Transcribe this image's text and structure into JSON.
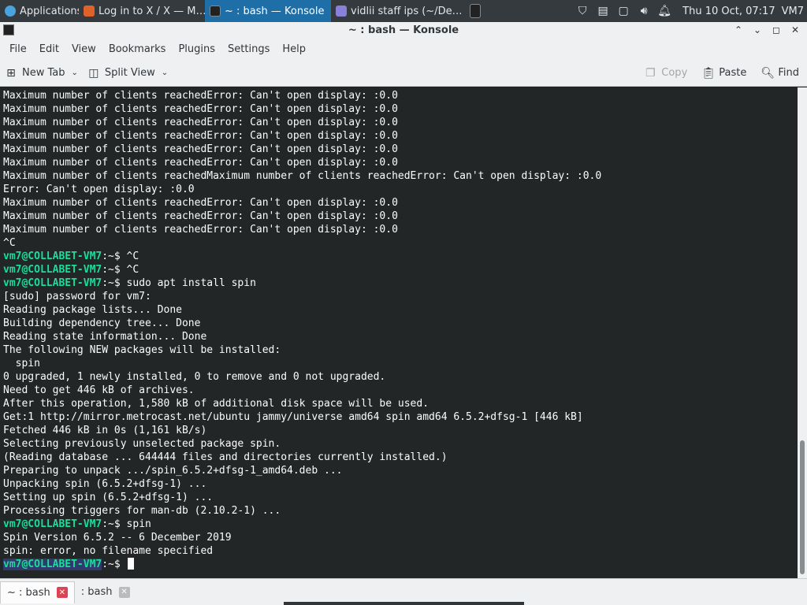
{
  "taskbar": {
    "tasks": [
      {
        "label": "Applications ⁝",
        "icon": "applications-icon"
      },
      {
        "label": "Log in to X / X — M…",
        "icon": "firefox-icon"
      },
      {
        "label": "~ : bash — Konsole",
        "icon": "terminal-icon",
        "active": true
      },
      {
        "label": "vidlii staff ips (~/De…",
        "icon": "text-editor-icon"
      },
      {
        "label": "",
        "icon": "terminal-icon"
      }
    ],
    "clock": "Thu 10 Oct, 07:17",
    "user": "VM7"
  },
  "window": {
    "title": "~ : bash — Konsole"
  },
  "menubar": {
    "items": [
      "File",
      "Edit",
      "View",
      "Bookmarks",
      "Plugins",
      "Settings",
      "Help"
    ]
  },
  "toolbar": {
    "new_tab": "New Tab",
    "split_view": "Split View",
    "copy": "Copy",
    "paste": "Paste",
    "find": "Find"
  },
  "terminal": {
    "prompt": "vm7@COLLABET-VM7",
    "prompt_suffix": ":~$ ",
    "lines": [
      {
        "text": "Maximum number of clients reachedError: Can't open display: :0.0"
      },
      {
        "text": "Maximum number of clients reachedError: Can't open display: :0.0"
      },
      {
        "text": "Maximum number of clients reachedError: Can't open display: :0.0"
      },
      {
        "text": "Maximum number of clients reachedError: Can't open display: :0.0"
      },
      {
        "text": "Maximum number of clients reachedError: Can't open display: :0.0"
      },
      {
        "text": "Maximum number of clients reachedError: Can't open display: :0.0"
      },
      {
        "text": "Maximum number of clients reachedMaximum number of clients reachedError: Can't open display: :0.0"
      },
      {
        "text": "Error: Can't open display: :0.0"
      },
      {
        "text": "Maximum number of clients reachedError: Can't open display: :0.0"
      },
      {
        "text": "Maximum number of clients reachedError: Can't open display: :0.0"
      },
      {
        "text": "Maximum number of clients reachedError: Can't open display: :0.0"
      },
      {
        "text": "^C"
      },
      {
        "prompt": true,
        "cmd": "^C"
      },
      {
        "prompt": true,
        "cmd": "^C"
      },
      {
        "prompt": true,
        "cmd": "sudo apt install spin"
      },
      {
        "text": "[sudo] password for vm7:"
      },
      {
        "text": "Reading package lists... Done"
      },
      {
        "text": "Building dependency tree... Done"
      },
      {
        "text": "Reading state information... Done"
      },
      {
        "text": "The following NEW packages will be installed:"
      },
      {
        "text": "  spin"
      },
      {
        "text": "0 upgraded, 1 newly installed, 0 to remove and 0 not upgraded."
      },
      {
        "text": "Need to get 446 kB of archives."
      },
      {
        "text": "After this operation, 1,580 kB of additional disk space will be used."
      },
      {
        "text": "Get:1 http://mirror.metrocast.net/ubuntu jammy/universe amd64 spin amd64 6.5.2+dfsg-1 [446 kB]"
      },
      {
        "text": "Fetched 446 kB in 0s (1,161 kB/s)"
      },
      {
        "text": "Selecting previously unselected package spin."
      },
      {
        "text": "(Reading database ... 644444 files and directories currently installed.)"
      },
      {
        "text": "Preparing to unpack .../spin_6.5.2+dfsg-1_amd64.deb ..."
      },
      {
        "text": "Unpacking spin (6.5.2+dfsg-1) ..."
      },
      {
        "text": "Setting up spin (6.5.2+dfsg-1) ..."
      },
      {
        "text": "Processing triggers for man-db (2.10.2-1) ..."
      },
      {
        "prompt": true,
        "cmd": "spin"
      },
      {
        "text": "Spin Version 6.5.2 -- 6 December 2019"
      },
      {
        "text": "spin: error, no filename specified"
      },
      {
        "prompt": true,
        "cmd": "",
        "cursor": true
      }
    ]
  },
  "tabs": [
    {
      "label": "~ : bash",
      "active": true
    },
    {
      "label": ": bash",
      "active": false
    }
  ],
  "colors": {
    "prompt": "#1cdc9a",
    "terminal_bg": "#232627",
    "active_task": "#1e6fa8",
    "tab_close": "#da4453"
  }
}
